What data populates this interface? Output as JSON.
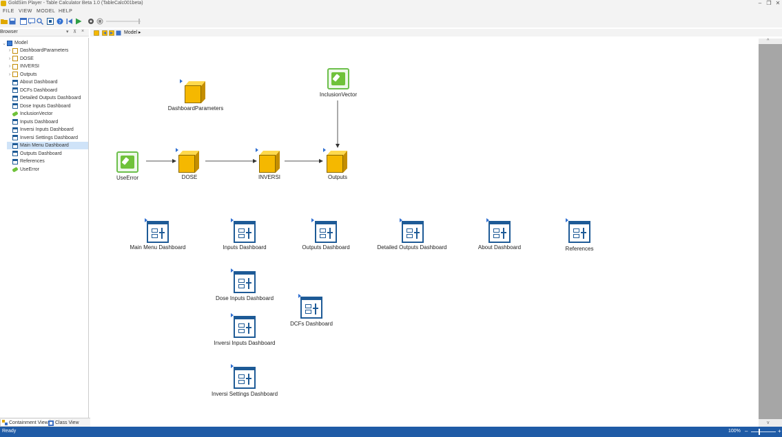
{
  "window": {
    "title": "GoldSim Player - Table Calculator Beta 1.0 (TableCalc001beta)",
    "minimize": "–",
    "restore": "❐",
    "close": "✕"
  },
  "menu": [
    "FILE",
    "VIEW",
    "MODEL",
    "HELP"
  ],
  "browser": {
    "title": "Browser",
    "pin": "▾",
    "float": "⊼",
    "close": "×"
  },
  "breadcrumb": "Model ▸",
  "tree": {
    "root": "Model",
    "items": [
      {
        "label": "DashboardParameters",
        "type": "folder",
        "expand": "›"
      },
      {
        "label": "DOSE",
        "type": "folder",
        "expand": "›"
      },
      {
        "label": "INVERSI",
        "type": "folder",
        "expand": "›"
      },
      {
        "label": "Outputs",
        "type": "folder",
        "expand": "›"
      },
      {
        "label": "About Dashboard",
        "type": "dashboard"
      },
      {
        "label": "DCFs Dashboard",
        "type": "dashboard"
      },
      {
        "label": "Detailed Outputs Dashboard",
        "type": "dashboard"
      },
      {
        "label": "Dose Inputs Dashboard",
        "type": "dashboard"
      },
      {
        "label": "InclusionVector",
        "type": "data"
      },
      {
        "label": "Inputs Dashboard",
        "type": "dashboard"
      },
      {
        "label": "Inversi Inputs Dashboard",
        "type": "dashboard"
      },
      {
        "label": "Inversi Settings Dashboard",
        "type": "dashboard"
      },
      {
        "label": "Main Menu Dashboard",
        "type": "dashboard",
        "selected": true
      },
      {
        "label": "Outputs Dashboard",
        "type": "dashboard"
      },
      {
        "label": "References",
        "type": "dashboard"
      },
      {
        "label": "UseError",
        "type": "data"
      }
    ]
  },
  "tabs": {
    "containment": "Containment View",
    "class": "Class View"
  },
  "canvas": {
    "containers": {
      "dashboard_parameters": "DashboardParameters",
      "dose": "DOSE",
      "inversi": "INVERSI",
      "outputs": "Outputs"
    },
    "data_elements": {
      "inclusion_vector": "InclusionVector",
      "use_error": "UseError"
    },
    "dashboards": {
      "main_menu": "Main Menu Dashboard",
      "inputs": "Inputs Dashboard",
      "outputs": "Outputs Dashboard",
      "detailed_outputs": "Detailed Outputs Dashboard",
      "about": "About Dashboard",
      "references": "References",
      "dose_inputs": "Dose Inputs Dashboard",
      "dcfs": "DCFs Dashboard",
      "inversi_inputs": "Inversi Inputs Dashboard",
      "inversi_settings": "Inversi Settings Dashboard"
    }
  },
  "status": {
    "text": "Ready",
    "zoom": "100%",
    "zoom_minus": "–",
    "zoom_plus": "+"
  },
  "scroll": {
    "up": "^",
    "down": "v"
  },
  "colors": {
    "status_bar": "#1f5ba6",
    "container": "#f5b800",
    "dashboard": "#1d5a96",
    "data_element": "#6fc23a",
    "selection": "#cfe3f8"
  }
}
